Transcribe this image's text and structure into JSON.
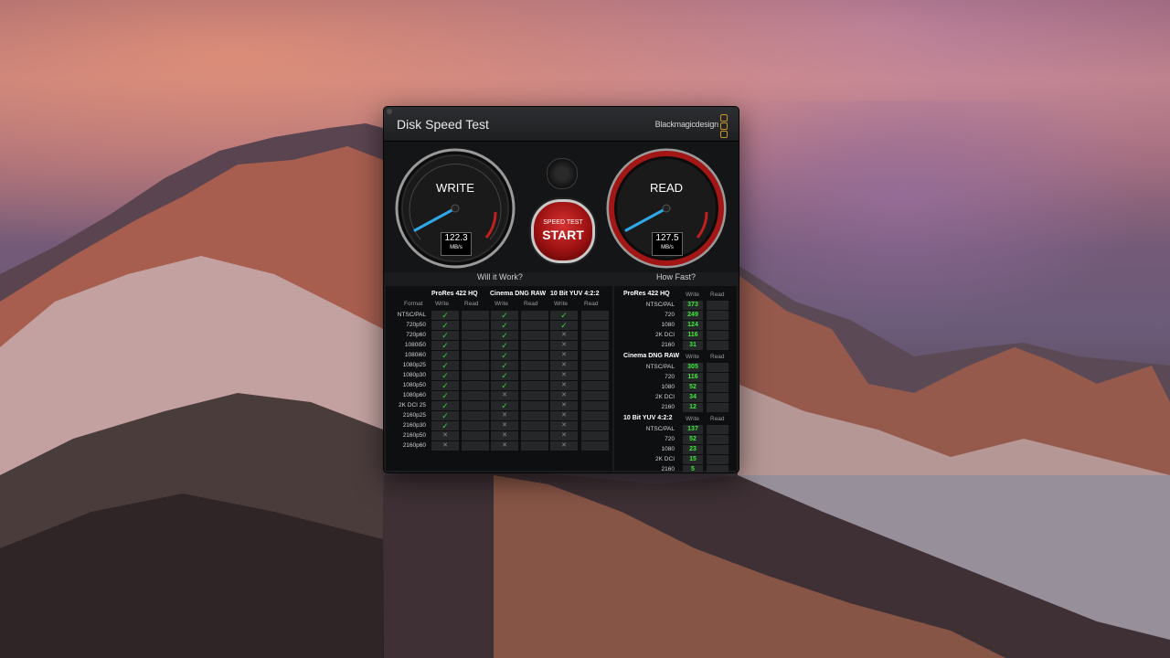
{
  "window": {
    "title": "Disk Speed Test",
    "brand": "Blackmagicdesign"
  },
  "gauges": {
    "write": {
      "label": "WRITE",
      "value": "122.3",
      "unit": "MB/s"
    },
    "read": {
      "label": "READ",
      "value": "127.5",
      "unit": "MB/s"
    },
    "start_small": "SPEED TEST",
    "start_big": "START"
  },
  "sections": {
    "left_title": "Will it Work?",
    "right_title": "How Fast?"
  },
  "will_it_work": {
    "groups": [
      "ProRes 422 HQ",
      "Cinema DNG RAW",
      "10 Bit YUV 4:2:2"
    ],
    "format_header": "Format",
    "write_header": "Write",
    "read_header": "Read",
    "rows": [
      {
        "format": "NTSC/PAL",
        "w": [
          "ok",
          "ok",
          "ok"
        ]
      },
      {
        "format": "720p50",
        "w": [
          "ok",
          "ok",
          "ok"
        ]
      },
      {
        "format": "720p60",
        "w": [
          "ok",
          "ok",
          "no"
        ]
      },
      {
        "format": "1080i50",
        "w": [
          "ok",
          "ok",
          "no"
        ]
      },
      {
        "format": "1080i60",
        "w": [
          "ok",
          "ok",
          "no"
        ]
      },
      {
        "format": "1080p25",
        "w": [
          "ok",
          "ok",
          "no"
        ]
      },
      {
        "format": "1080p30",
        "w": [
          "ok",
          "ok",
          "no"
        ]
      },
      {
        "format": "1080p50",
        "w": [
          "ok",
          "ok",
          "no"
        ]
      },
      {
        "format": "1080p60",
        "w": [
          "ok",
          "no",
          "no"
        ]
      },
      {
        "format": "2K DCI 25",
        "w": [
          "ok",
          "ok",
          "no"
        ]
      },
      {
        "format": "2160p25",
        "w": [
          "ok",
          "no",
          "no"
        ]
      },
      {
        "format": "2160p30",
        "w": [
          "ok",
          "no",
          "no"
        ]
      },
      {
        "format": "2160p50",
        "w": [
          "no",
          "no",
          "no"
        ]
      },
      {
        "format": "2160p60",
        "w": [
          "no",
          "no",
          "no"
        ]
      }
    ],
    "check_glyph": "✓",
    "cross_glyph": "✕",
    "dash": "— —"
  },
  "how_fast": {
    "write_header": "Write",
    "read_header": "Read",
    "groups": [
      {
        "name": "ProRes 422 HQ",
        "rows": [
          {
            "label": "NTSC/PAL",
            "value": "373"
          },
          {
            "label": "720",
            "value": "249"
          },
          {
            "label": "1080",
            "value": "124"
          },
          {
            "label": "2K DCI",
            "value": "116"
          },
          {
            "label": "2160",
            "value": "31"
          }
        ]
      },
      {
        "name": "Cinema DNG RAW",
        "rows": [
          {
            "label": "NTSC/PAL",
            "value": "305"
          },
          {
            "label": "720",
            "value": "116"
          },
          {
            "label": "1080",
            "value": "52"
          },
          {
            "label": "2K DCI",
            "value": "34"
          },
          {
            "label": "2160",
            "value": "12"
          }
        ]
      },
      {
        "name": "10 Bit YUV 4:2:2",
        "rows": [
          {
            "label": "NTSC/PAL",
            "value": "137"
          },
          {
            "label": "720",
            "value": "52"
          },
          {
            "label": "1080",
            "value": "23"
          },
          {
            "label": "2K DCI",
            "value": "15"
          },
          {
            "label": "2160",
            "value": "5"
          }
        ]
      }
    ],
    "dash": "— —"
  },
  "colors": {
    "ok": "#3bd13b",
    "value_green": "#3bea3b",
    "start_red": "#c41e1e"
  }
}
